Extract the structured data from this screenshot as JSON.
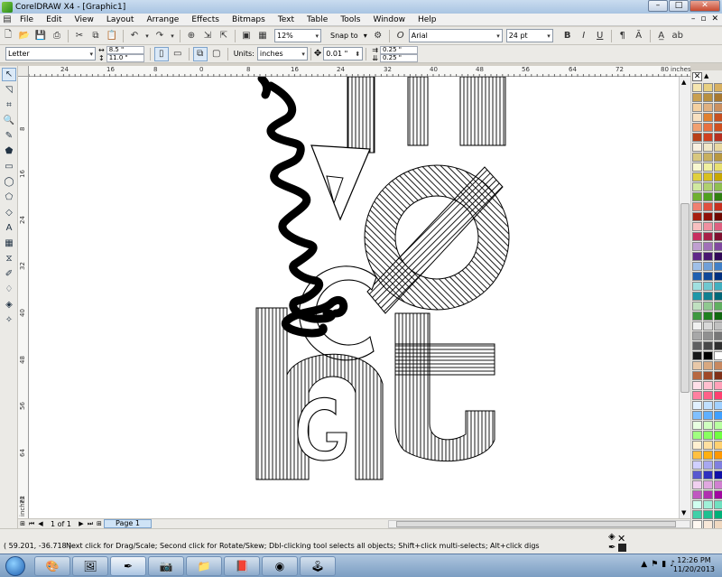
{
  "window": {
    "title": "CorelDRAW X4 - [Graphic1]",
    "minimize": "–",
    "maximize": "□",
    "close": "✕"
  },
  "menu": {
    "items": [
      "File",
      "Edit",
      "View",
      "Layout",
      "Arrange",
      "Effects",
      "Bitmaps",
      "Text",
      "Table",
      "Tools",
      "Window",
      "Help"
    ],
    "doc_controls": [
      "–",
      "▫",
      "✕"
    ]
  },
  "toolbar": {
    "zoom": "12%",
    "snap_to": "Snap to",
    "font_name": "Arial",
    "font_size": "24 pt"
  },
  "property_bar": {
    "paper": "Letter",
    "width": "8.5 \"",
    "height": "11.0 \"",
    "units_label": "Units:",
    "units": "inches",
    "nudge": "0.01 \"",
    "dup_x": "0.25 \"",
    "dup_y": "0.25 \""
  },
  "rulers": {
    "top": [
      "24",
      "16",
      "8",
      "0",
      "8",
      "16",
      "24",
      "32",
      "40",
      "48",
      "56",
      "64",
      "72",
      "80",
      "inches"
    ],
    "left": [
      "8",
      "16",
      "24",
      "32",
      "40",
      "48",
      "56",
      "64",
      "72",
      "inches"
    ]
  },
  "canvas": {
    "script_text": "lunch",
    "letter_G": "G",
    "letter_A": "A",
    "letter_C": "C"
  },
  "pager": {
    "count": "1 of 1",
    "tab": "Page 1"
  },
  "status": {
    "coords": "( 59.201, -36.718 )",
    "message": "Next click for Drag/Scale; Second click for Rotate/Skew; Dbl-clicking tool selects all objects; Shift+click multi-selects; Alt+click digs"
  },
  "taskbar": {
    "time": "12:26 PM",
    "date": "11/20/2013"
  },
  "palette": {
    "colors": [
      "#f5e6b0",
      "#e8d080",
      "#d8b060",
      "#c9a050",
      "#b89040",
      "#a87830",
      "#f4d0a0",
      "#e0b080",
      "#cc9060",
      "#f8e0c0",
      "#e08030",
      "#c85020",
      "#f0a070",
      "#e87040",
      "#d05020",
      "#b84018",
      "#d04020",
      "#b83020",
      "#f8f0e0",
      "#f0e8c8",
      "#e8d8a0",
      "#d8c880",
      "#c8b060",
      "#b89840",
      "#f8f8d0",
      "#f0f0a0",
      "#e8e070",
      "#e0d040",
      "#d8c020",
      "#c8a800",
      "#d0e8a0",
      "#b0d070",
      "#90c050",
      "#70b030",
      "#50a020",
      "#308010",
      "#f08070",
      "#e05040",
      "#c83020",
      "#a82010",
      "#901008",
      "#700800",
      "#f8c0c0",
      "#f090a0",
      "#e06080",
      "#c83060",
      "#a82048",
      "#801030",
      "#c0a0d0",
      "#a070b8",
      "#8048a0",
      "#602888",
      "#481870",
      "#300858",
      "#a0c0e8",
      "#70a0d8",
      "#4080c8",
      "#2060b0",
      "#104898",
      "#003080",
      "#a0e0e0",
      "#70c8d0",
      "#40b0c0",
      "#2098a8",
      "#108090",
      "#006878",
      "#c0e0c0",
      "#90c890",
      "#60b060",
      "#409840",
      "#208020",
      "#106810",
      "#f0f0f0",
      "#d8d8d8",
      "#c0c0c0",
      "#a8a8a8",
      "#909090",
      "#787878",
      "#606060",
      "#484848",
      "#303030",
      "#181818",
      "#000000",
      "#ffffff",
      "#e8c8a8",
      "#d8a880",
      "#c88860",
      "#b86840",
      "#a04828",
      "#803018",
      "#ffe0e8",
      "#ffc0d0",
      "#ffa0b8",
      "#ff80a0",
      "#ff6088",
      "#ff4070",
      "#e0f0ff",
      "#c0e0ff",
      "#a0d0ff",
      "#80c0ff",
      "#60b0ff",
      "#40a0ff",
      "#e8ffe0",
      "#d0ffc0",
      "#b8ffa0",
      "#a0ff80",
      "#88ff60",
      "#70ff40",
      "#fff0d0",
      "#ffe0a0",
      "#ffd070",
      "#ffc040",
      "#ffb010",
      "#ff9800",
      "#d0d0ff",
      "#a8a8f0",
      "#8080e0",
      "#5858d0",
      "#3030c0",
      "#1010a8",
      "#f0d0f0",
      "#e0a8e0",
      "#d080d0",
      "#c058c0",
      "#b030b0",
      "#a008a0",
      "#d0fff0",
      "#a0f0d8",
      "#70e0c0",
      "#40d0a8",
      "#20c090",
      "#00b078",
      "#fff8f0",
      "#f8e8d8",
      "#f0d8c0",
      "#e8c8a8",
      "#e0b890",
      "#d8a878"
    ]
  }
}
